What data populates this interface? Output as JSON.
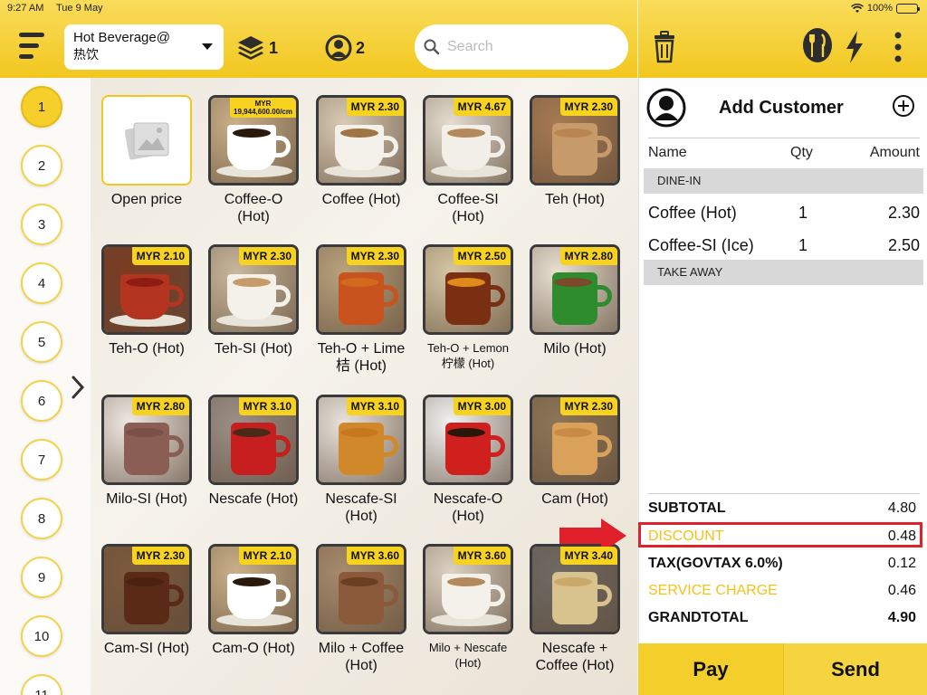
{
  "status_bar": {
    "time": "9:27 AM",
    "date": "Tue 9 May",
    "battery": "100%",
    "battery_level": 1.0
  },
  "header": {
    "category_line1": "Hot Beverage@",
    "category_line2": "热饮",
    "tables_count": "1",
    "people_count": "2",
    "search_placeholder": "Search"
  },
  "table_numbers": [
    "1",
    "2",
    "3",
    "4",
    "5",
    "6",
    "7",
    "8",
    "9",
    "10",
    "11"
  ],
  "active_table": "1",
  "products": [
    {
      "name": "Open price",
      "price": "",
      "kind": "open"
    },
    {
      "name": "Coffee-O (Hot)",
      "price": "MYR 19,944,600.00/cm",
      "kind": "small",
      "bg": "#c9b089",
      "cup": "#ffffff",
      "liquid": "#2a1a0e"
    },
    {
      "name": "Coffee (Hot)",
      "price": "MYR 2.30",
      "bg": "#d9cbb3",
      "cup": "#f4f1ea",
      "liquid": "#a07445"
    },
    {
      "name": "Coffee-SI (Hot)",
      "price": "MYR 4.67",
      "bg": "#e5ddd0",
      "cup": "#f2efe8",
      "liquid": "#b48a5c"
    },
    {
      "name": "Teh (Hot)",
      "price": "MYR 2.30",
      "bg": "#a67a52",
      "cup": "#c79a6a",
      "liquid": "#b98652",
      "mug": true
    },
    {
      "name": "Teh-O (Hot)",
      "price": "MYR 2.10",
      "bg": "#7b3b22",
      "cup": "#b3341f",
      "liquid": "#8c1d10"
    },
    {
      "name": "Teh-SI (Hot)",
      "price": "MYR 2.30",
      "bg": "#c9b79b",
      "cup": "#f4f1ea",
      "liquid": "#c79a6a"
    },
    {
      "name": "Teh-O + Lime 桔 (Hot)",
      "price": "MYR 2.30",
      "bg": "#b9a27c",
      "cup": "#c8531f",
      "liquid": "#d2691e",
      "mug": true
    },
    {
      "name": "Teh-O + Lemon 柠檬 (Hot)",
      "price": "MYR 2.50",
      "kind": "sm",
      "bg": "#d7c6a4",
      "cup": "#7a2e12",
      "liquid": "#e08a1a",
      "mug": true
    },
    {
      "name": "Milo (Hot)",
      "price": "MYR 2.80",
      "bg": "#e8e0d2",
      "cup": "#2e8b2e",
      "liquid": "#7a4a2a",
      "mug": true
    },
    {
      "name": "Milo-SI (Hot)",
      "price": "MYR 2.80",
      "bg": "#efe8e2",
      "cup": "#8a5e55",
      "liquid": "#7a5048",
      "mug": true
    },
    {
      "name": "Nescafe (Hot)",
      "price": "MYR 3.10",
      "bg": "#9b8f86",
      "cup": "#c71f1f",
      "liquid": "#4a2a16",
      "mug": true
    },
    {
      "name": "Nescafe-SI (Hot)",
      "price": "MYR 3.10",
      "bg": "#e9e3dc",
      "cup": "#d1882a",
      "liquid": "#c7781f",
      "mug": true
    },
    {
      "name": "Nescafe-O (Hot)",
      "price": "MYR 3.00",
      "bg": "#f2f2f2",
      "cup": "#d0201e",
      "liquid": "#2a170b",
      "mug": true
    },
    {
      "name": "Cam (Hot)",
      "price": "MYR 2.30",
      "bg": "#8d7556",
      "cup": "#d9a15a",
      "liquid": "#c98a45",
      "mug": true
    },
    {
      "name": "Cam-SI (Hot)",
      "price": "MYR 2.30",
      "bg": "#7c5a3c",
      "cup": "#5a2a16",
      "liquid": "#4a2210",
      "mug": true
    },
    {
      "name": "Cam-O (Hot)",
      "price": "MYR 2.10",
      "bg": "#c9b089",
      "cup": "#ffffff",
      "liquid": "#2a1a0e"
    },
    {
      "name": "Milo + Coffee (Hot)",
      "price": "MYR 3.60",
      "bg": "#a78b6c",
      "cup": "#8a5a3a",
      "liquid": "#6b3f22",
      "mug": true
    },
    {
      "name": "Milo + Nescafe (Hot)",
      "price": "MYR 3.60",
      "kind": "sm",
      "bg": "#dcd2c2",
      "cup": "#f4f1ea",
      "liquid": "#b48a5c"
    },
    {
      "name": "Nescafe + Coffee (Hot)",
      "price": "MYR 3.40",
      "bg": "#6f6a64",
      "cup": "#d8c28e",
      "liquid": "#c9a86a",
      "mug": true
    }
  ],
  "order": {
    "customer_label": "Add Customer",
    "columns": {
      "name": "Name",
      "qty": "Qty",
      "amount": "Amount"
    },
    "sections": [
      {
        "title": "DINE-IN",
        "items": [
          {
            "name": "Coffee (Hot)",
            "qty": "1",
            "amount": "2.30"
          },
          {
            "name": "Coffee-SI (Ice)",
            "qty": "1",
            "amount": "2.50"
          }
        ]
      },
      {
        "title": "TAKE AWAY",
        "items": []
      }
    ],
    "totals": [
      {
        "label": "SUBTOTAL",
        "value": "4.80",
        "style": "bold"
      },
      {
        "label": "DISCOUNT",
        "value": "0.48",
        "style": "gold"
      },
      {
        "label": "TAX(GOVTAX 6.0%)",
        "value": "0.12",
        "style": "bold"
      },
      {
        "label": "SERVICE CHARGE",
        "value": "0.46",
        "style": "gold"
      },
      {
        "label": "GRANDTOTAL",
        "value": "4.90",
        "style": "bold"
      }
    ]
  },
  "actions": {
    "pay": "Pay",
    "send": "Send"
  },
  "colors": {
    "accent": "#f2c71f",
    "highlight": "#e0202a",
    "gold_text": "#f1c21a"
  }
}
